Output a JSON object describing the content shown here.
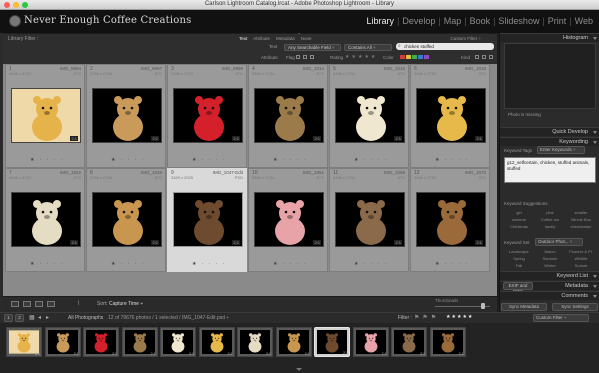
{
  "window": {
    "title": "Carlson Lightroom Catalog.lrcat - Adobe Photoshop Lightroom - Library"
  },
  "identity": {
    "brand": "Never Enough Coffee Creations"
  },
  "modules": [
    "Library",
    "Develop",
    "Map",
    "Book",
    "Slideshow",
    "Print",
    "Web"
  ],
  "active_module": "Library",
  "filter_bar": {
    "title": "Library Filter :",
    "tabs": [
      "Text",
      "Attribute",
      "Metadata",
      "None"
    ],
    "active_tab": "Text",
    "custom_filter": "Custom Filter ÷",
    "text_label": "Text",
    "field_select": "Any Searchable Field ÷",
    "rule_select": "Contains All ÷",
    "search_value": "chicken stuffed",
    "attribute_label": "Attribute",
    "flag_label": "Flag",
    "rating_label": "Rating",
    "color_label": "Color",
    "kind_label": "Kind"
  },
  "colors": {
    "red": "#d23b3b",
    "yellow": "#d9c23b",
    "green": "#3fae4b",
    "blue": "#3b7bd2",
    "purple": "#8d4bbf",
    "accent_bg": "#8a8a8a"
  },
  "grid": [
    {
      "num": "1",
      "name": "IMG_9994",
      "dims": "3456 x 2784",
      "ext": "JPG",
      "stars": "★ · · · ·",
      "badge": "2:1",
      "icon": "cartoon-lion-plush-icon"
    },
    {
      "num": "2",
      "name": "IMG_9997",
      "dims": "3456 x 2784",
      "ext": "JPG",
      "stars": "★ · · · ·",
      "badge": "2:1",
      "icon": "long-eared-dog-plush-icon"
    },
    {
      "num": "3",
      "name": "IMG_9999",
      "dims": "3456 x 2784",
      "ext": "JPG",
      "stars": "★ · · · ·",
      "badge": "2:1",
      "icon": "red-dragon-plush-icon"
    },
    {
      "num": "4",
      "name": "IMG_1014",
      "dims": "3456 x 2784",
      "ext": "JPG",
      "stars": "★ · · · ·",
      "badge": "2:1",
      "icon": "hedgehog-plush-icon"
    },
    {
      "num": "5",
      "name": "IMG_1016",
      "dims": "3456 x 2784",
      "ext": "JPG",
      "stars": "★ · · · ·",
      "badge": "2:1",
      "icon": "white-dog-plush-icon"
    },
    {
      "num": "6",
      "name": "IMG_1019",
      "dims": "3456 x 2784",
      "ext": "JPG",
      "stars": "★ · · · ·",
      "badge": "2:1",
      "icon": "giraffe-plush-icon"
    },
    {
      "num": "7",
      "name": "IMG_1022",
      "dims": "3456 x 2784",
      "ext": "JPG",
      "stars": "★ · · · ·",
      "badge": "2:1",
      "icon": "cream-bunny-plush-icon"
    },
    {
      "num": "8",
      "name": "IMG_1026",
      "dims": "3456 x 2784",
      "ext": "JPG",
      "stars": "★ · · · ·",
      "badge": "2:1",
      "icon": "bunny-plush-icon"
    },
    {
      "num": "9",
      "name": "IMG_1047-Edit",
      "dims": "3329 x 2925",
      "ext": "PSD",
      "stars": "★ · · · ·",
      "badge": "2:1",
      "icon": "brown-bear-plush-icon"
    },
    {
      "num": "10",
      "name": "IMG_1051",
      "dims": "3456 x 2784",
      "ext": "JPG",
      "stars": "★ · · · ·",
      "badge": "2:1",
      "icon": "minnie-mouse-plush-icon"
    },
    {
      "num": "11",
      "name": "IMG_1069",
      "dims": "3456 x 2784",
      "ext": "JPG",
      "stars": "★ · · · ·",
      "badge": "2:1",
      "icon": "squirrel-plush-icon"
    },
    {
      "num": "12",
      "name": "IMG_1072",
      "dims": "3456 x 2784",
      "ext": "JPG",
      "stars": "★ · · · ·",
      "badge": "2:1",
      "icon": "teddy-bear-plush-icon"
    }
  ],
  "selected_index": 8,
  "toolbar": {
    "sort_label": "Sort:",
    "sort_value": "Capture Time ÷",
    "thumbs_label": "Thumbnails"
  },
  "right_panel": {
    "histogram": "Histogram",
    "photo_missing": "Photo is missing",
    "quick_develop": "Quick Develop",
    "keywording": "Keywording",
    "keyword_tags_label": "Keyword Tags",
    "keyword_tags_value": "Enter Keywords ÷",
    "keywords_text": "g12_selfcertain, chicken, stuffed animals, stuffed",
    "keyword_suggestions": "Keyword Suggestions",
    "suggestions": [
      "girl",
      "pink",
      "smaller",
      "scheme",
      "Coffee mo",
      "Minnie Bos",
      "Christmas",
      "family",
      "cheerleader"
    ],
    "keyword_set_label": "Keyword Set",
    "keyword_set_value": "Outdoor Phot... ÷",
    "sets": [
      "Landscape",
      "Macro",
      "Flowers & Pl.",
      "Spring",
      "Summer",
      "Wildlife",
      "Fall",
      "Winter",
      "Sunset"
    ],
    "keyword_list": "Keyword List",
    "metadata_preset": "EXIF and IPTC",
    "metadata": "Metadata",
    "comments": "Comments",
    "sync_metadata": "Sync Metadata",
    "sync_settings": "Sync Settings"
  },
  "filmstrip": {
    "source": "All Photographs",
    "count": "12 of 79676 photos / 1 selected / IMG_1047-Edit.psd ÷",
    "filter_label": "Filter :",
    "custom_filter": "Custom Filter ÷",
    "page1": "1",
    "page2": "2"
  }
}
